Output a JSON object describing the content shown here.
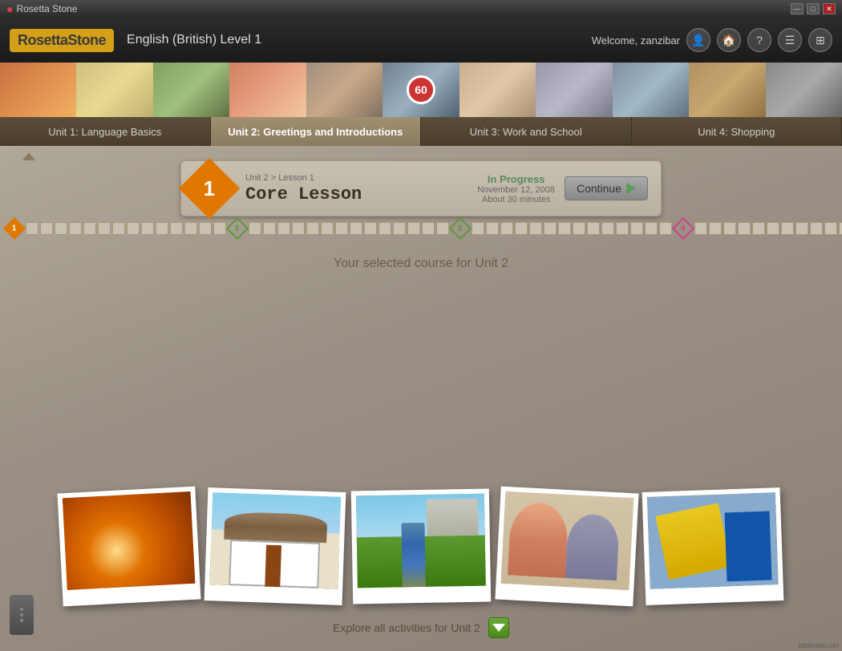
{
  "app": {
    "title": "Rosetta Stone",
    "icon": "●"
  },
  "header": {
    "logo": "RosettaStone",
    "course_title": "English (British) Level 1",
    "welcome": "Welcome, zanzibar",
    "win_min": "—",
    "win_max": "□",
    "win_close": "✕"
  },
  "unit_tabs": [
    {
      "label": "Unit 1: Language Basics",
      "active": false
    },
    {
      "label": "Unit 2: Greetings and Introductions",
      "active": true
    },
    {
      "label": "Unit 3: Work and School",
      "active": false
    },
    {
      "label": "Unit 4: Shopping",
      "active": false
    }
  ],
  "lesson_card": {
    "badge_number": "1",
    "subtitle": "Unit 2 > Lesson 1",
    "title": "Core Lesson",
    "status": "In Progress",
    "date": "November 12, 2008",
    "duration": "About 30 minutes",
    "continue_label": "Continue"
  },
  "progress": {
    "segments": [
      {
        "type": "diamond",
        "color": "orange",
        "num": "1"
      },
      {
        "type": "squares",
        "count": 14,
        "filled": 0
      },
      {
        "type": "diamond",
        "color": "green",
        "num": "2"
      },
      {
        "type": "squares",
        "count": 14,
        "filled": 0
      },
      {
        "type": "diamond",
        "color": "green",
        "num": "3"
      },
      {
        "type": "squares",
        "count": 14,
        "filled": 0
      },
      {
        "type": "diamond",
        "color": "pink",
        "num": "4"
      },
      {
        "type": "squares",
        "count": 14,
        "filled": 0
      },
      {
        "type": "diamond",
        "color": "gold",
        "num": "●"
      }
    ]
  },
  "main": {
    "selected_course_text": "Your selected course for Unit 2"
  },
  "explore": {
    "text": "Explore all activities for Unit 2"
  },
  "photos": [
    {
      "desc": "Child with torch in tent",
      "class": "photo-1"
    },
    {
      "desc": "Thatched cottage",
      "class": "photo-2"
    },
    {
      "desc": "Child in garden",
      "class": "photo-3"
    },
    {
      "desc": "Woman and girl at table",
      "class": "photo-4"
    },
    {
      "desc": "Yellow book and door",
      "class": "photo-5"
    }
  ],
  "watermark": "biblioteki.net"
}
